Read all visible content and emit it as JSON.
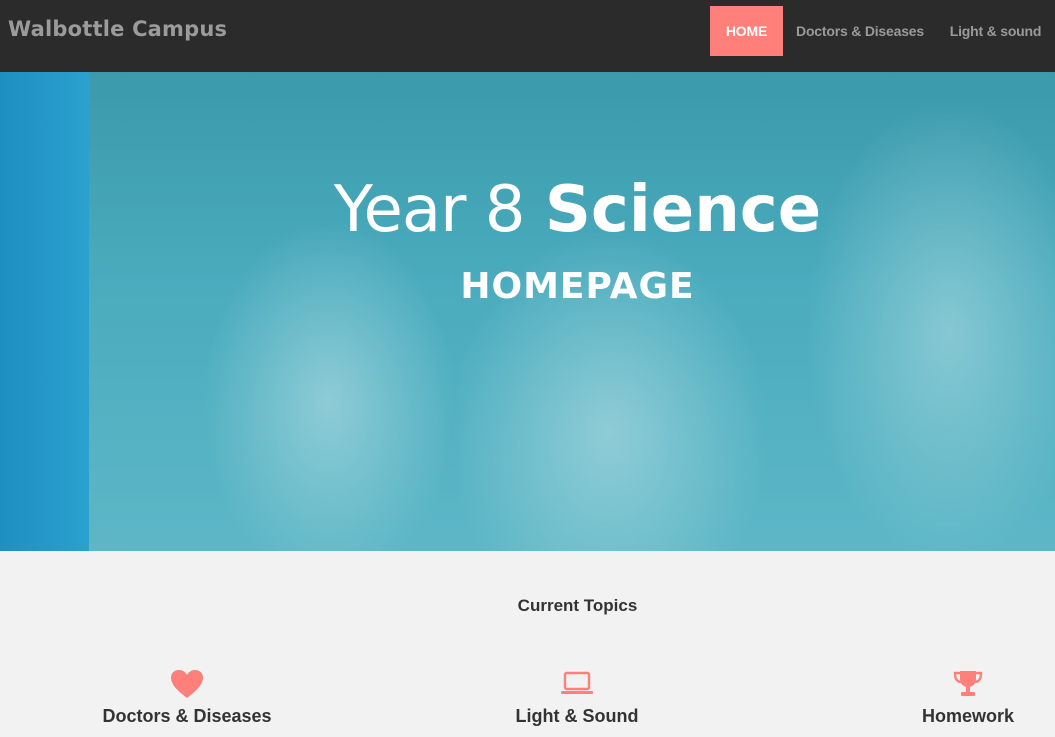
{
  "navbar": {
    "brand": "Walbottle Campus",
    "links": [
      {
        "label": "HOME",
        "active": true
      },
      {
        "label": "Doctors & Diseases",
        "active": false
      },
      {
        "label": "Light & sound",
        "active": false
      }
    ],
    "accent_color": "#ff7f7a"
  },
  "hero": {
    "title_light": "Year 8",
    "title_bold": "Science",
    "subtitle": "HOMEPAGE"
  },
  "topics_section": {
    "title": "Current Topics",
    "topics": [
      {
        "label": "Doctors & Diseases",
        "icon": "heart-icon"
      },
      {
        "label": "Light & Sound",
        "icon": "laptop-icon"
      },
      {
        "label": "Homework",
        "icon": "trophy-icon"
      }
    ],
    "icon_color": "#ff7f7a"
  }
}
